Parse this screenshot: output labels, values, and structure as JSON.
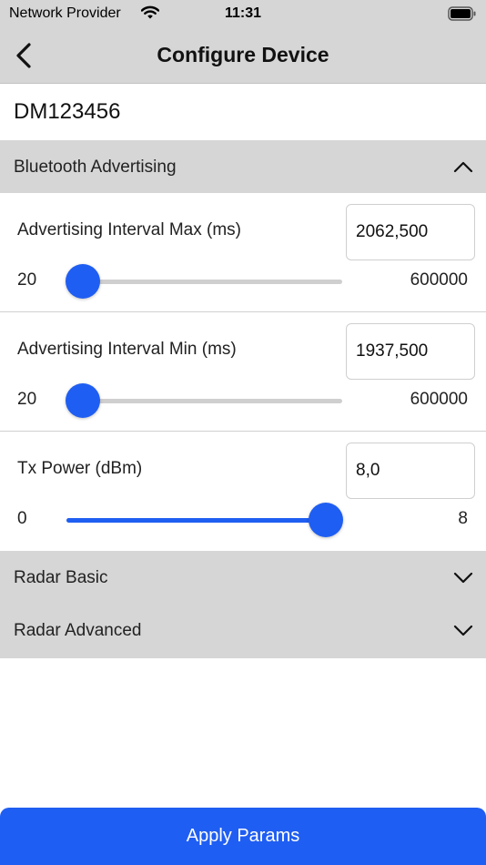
{
  "status_bar": {
    "carrier": "Network Provider",
    "time": "11:31",
    "wifi_icon": "wifi-icon",
    "battery_icon": "battery-icon"
  },
  "nav": {
    "title": "Configure Device",
    "back_icon": "chevron-left-icon"
  },
  "device": {
    "id": "DM123456"
  },
  "sections": {
    "bluetooth": {
      "label": "Bluetooth Advertising",
      "expanded": true,
      "chevron": "chevron-up-icon"
    },
    "radar_basic": {
      "label": "Radar Basic",
      "expanded": false,
      "chevron": "chevron-down-icon"
    },
    "radar_advanced": {
      "label": "Radar Advanced",
      "expanded": false,
      "chevron": "chevron-down-icon"
    }
  },
  "params": [
    {
      "label": "Advertising Interval Max (ms)",
      "value": "2062,500",
      "min": "20",
      "max": "600000",
      "slider_fraction": 0.06
    },
    {
      "label": "Advertising Interval Min (ms)",
      "value": "1937,500",
      "min": "20",
      "max": "600000",
      "slider_fraction": 0.06
    },
    {
      "label": "Tx Power (dBm)",
      "value": "8,0",
      "min": "0",
      "max": "8",
      "slider_fraction": 0.94
    }
  ],
  "actions": {
    "apply_label": "Apply Params"
  },
  "colors": {
    "accent": "#1f5ef2",
    "header_background": "#d6d6d6",
    "track": "#cfcfcf"
  }
}
